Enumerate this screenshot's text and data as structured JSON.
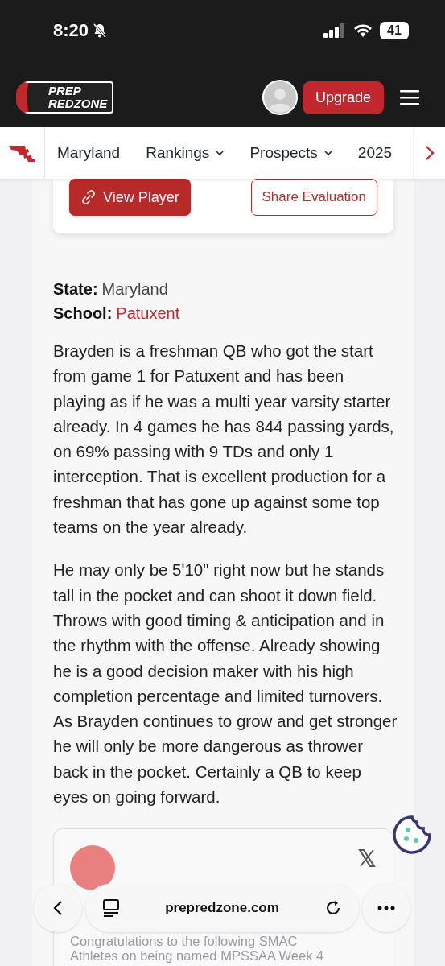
{
  "status_bar": {
    "time": "8:20",
    "battery": "41",
    "silent": true
  },
  "header": {
    "logo_top": "PREP",
    "logo_bottom": "REDZONE",
    "upgrade": "Upgrade"
  },
  "nav": {
    "items": [
      {
        "label": "Maryland",
        "dropdown": false
      },
      {
        "label": "Rankings",
        "dropdown": true
      },
      {
        "label": "Prospects",
        "dropdown": true
      },
      {
        "label": "2025",
        "dropdown": false
      }
    ]
  },
  "actions": {
    "view_player": "View Player",
    "share": "Share Evaluation"
  },
  "facts": [
    {
      "label": "State:",
      "value": "Maryland",
      "kind": "plain"
    },
    {
      "label": "School:",
      "value": "Patuxent",
      "kind": "link"
    }
  ],
  "paragraphs": [
    "Brayden is a freshman QB who got the start from game 1 for Patuxent and has been playing as if he was a multi year varsity starter already. In 4 games he has 844 passing yards, on 69% passing with 9 TDs and only 1 interception. That is excellent production for a freshman that has gone up against some top teams on the year already.",
    "He may only be 5'10\" right now but he stands tall in the pocket and can shoot it down field. Throws with good timing & anticipation and in the rhythm with the offense. Already showing he is a good decision maker with his high completion percentage and limited turnovers. As Brayden continues to grow and get stronger he will only be more dangerous as thrower back in the pocket. Certainly a QB to keep eyes on going forward."
  ],
  "embed": {
    "text": "Congratulations to the following SMAC Athletes on being named MPSSAA Week 4"
  },
  "browser_bar": {
    "url": "prepredzone.com"
  }
}
